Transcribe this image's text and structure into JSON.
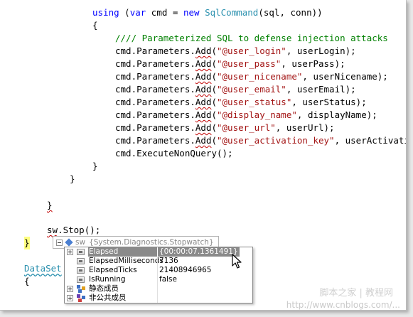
{
  "code": {
    "l1": {
      "kw_using": "using",
      "p1": " (",
      "kw_var": "var",
      "p2": " cmd = ",
      "kw_new": "new",
      "sp": " ",
      "type": "SqlCommand",
      "rest": "(sql, conn))"
    },
    "l2": "{",
    "l3": "//// Parameterized SQL to defense injection attacks",
    "params": [
      {
        "pre": "cmd.Parameters.",
        "method": "Add",
        "open": "(",
        "str": "\"@user_login\"",
        "rest": ", userLogin);"
      },
      {
        "pre": "cmd.Parameters.",
        "method": "Add",
        "open": "(",
        "str": "\"@user_pass\"",
        "rest": ", userPass);"
      },
      {
        "pre": "cmd.Parameters.",
        "method": "Add",
        "open": "(",
        "str": "\"@user_nicename\"",
        "rest": ", userNicename);"
      },
      {
        "pre": "cmd.Parameters.",
        "method": "Add",
        "open": "(",
        "str": "\"@user_email\"",
        "rest": ", userEmail);"
      },
      {
        "pre": "cmd.Parameters.",
        "method": "Add",
        "open": "(",
        "str": "\"@user_status\"",
        "rest": ", userStatus);"
      },
      {
        "pre": "cmd.Parameters.",
        "method": "Add",
        "open": "(",
        "str": "\"@display_name\"",
        "rest": ", displayName);"
      },
      {
        "pre": "cmd.Parameters.",
        "method": "Add",
        "open": "(",
        "str": "\"@user_url\"",
        "rest": ", userUrl);"
      },
      {
        "pre": "cmd.Parameters.",
        "method": "Add",
        "open": "(",
        "str": "\"@user_activation_key\"",
        "rest": ", userActivationK"
      }
    ],
    "execute": "cmd.ExecuteNonQuery();",
    "close_inner": "}",
    "close_using": "}",
    "close_try": "}",
    "sw_var": "sw",
    "sw_rest": ".Stop();",
    "close_method": "}",
    "dataset": "DataSet",
    "open_last": "{"
  },
  "datatip": {
    "var_name": "sw",
    "var_type": "{System.Diagnostics.Stopwatch}",
    "rows": [
      {
        "name": "Elapsed",
        "value": "{00:00:07.1361491}",
        "expandable": true,
        "selected": true,
        "icon": "property-icon"
      },
      {
        "name": "ElapsedMilliseconds",
        "value": "7136",
        "expandable": false,
        "selected": false,
        "icon": "property-icon"
      },
      {
        "name": "ElapsedTicks",
        "value": "21408946965",
        "expandable": false,
        "selected": false,
        "icon": "property-icon"
      },
      {
        "name": "IsRunning",
        "value": "false",
        "expandable": false,
        "selected": false,
        "icon": "property-icon"
      },
      {
        "name": "静态成员",
        "value": "",
        "expandable": true,
        "selected": false,
        "icon": "static-members-icon"
      },
      {
        "name": "非公共成员",
        "value": "",
        "expandable": true,
        "selected": false,
        "icon": "nonpublic-members-icon"
      }
    ]
  },
  "colors": {
    "keyword": "#0000ff",
    "type": "#2b91af",
    "string": "#a31515",
    "comment": "#008000",
    "selection": "#8a8a8a"
  },
  "watermark": {
    "top": "脚本之家 | 教程网",
    "bottom": "http://www.cnblogs.com/..."
  }
}
